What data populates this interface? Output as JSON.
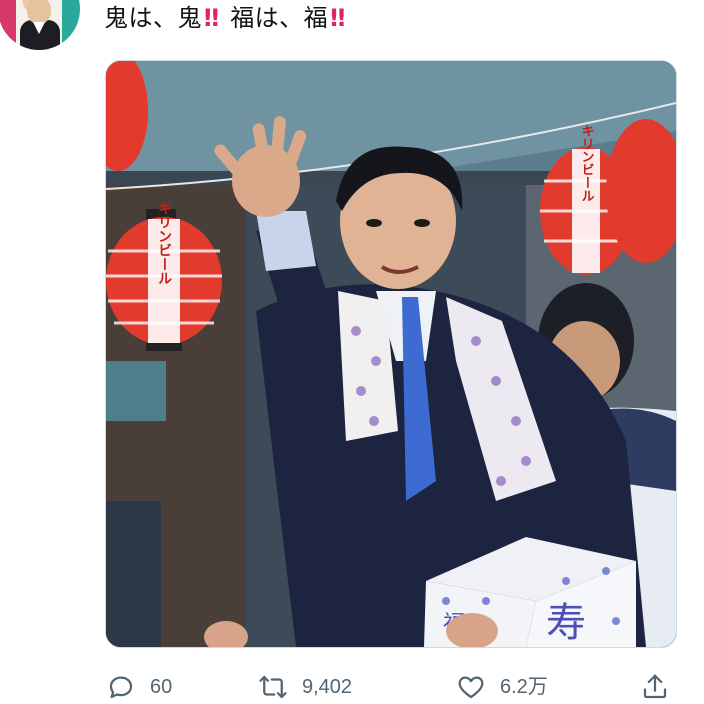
{
  "tweet": {
    "text_part1": "鬼は、鬼",
    "bang1": "‼",
    "text_part2": "福は、福",
    "bang2": "‼"
  },
  "media": {
    "lantern_text": "キリンビール",
    "box_text_main": "寿",
    "box_text_side": "福"
  },
  "actions": {
    "reply_count": "60",
    "retweet_count": "9,402",
    "like_count": "6.2万"
  },
  "colors": {
    "text": "#0f1419",
    "muted": "#536471",
    "bang": "#e0245e",
    "border": "#cfd9de"
  },
  "icons": {
    "reply": "reply-bubble-icon",
    "retweet": "retweet-arrows-icon",
    "like": "heart-icon",
    "share": "share-upload-icon"
  }
}
